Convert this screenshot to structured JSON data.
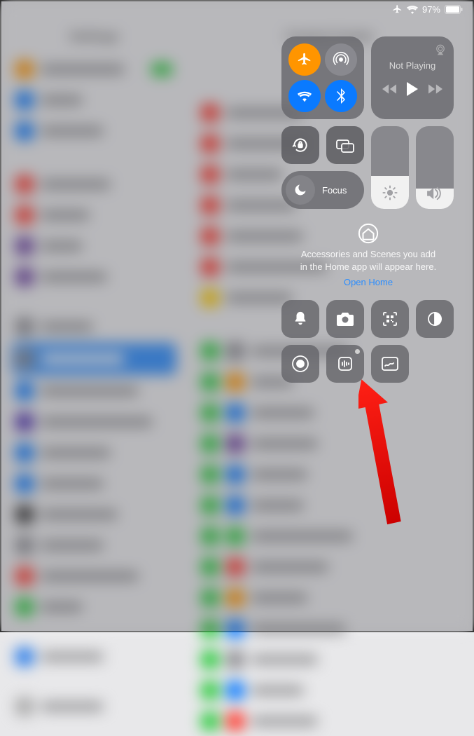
{
  "status": {
    "battery_percent": "97%"
  },
  "media": {
    "title": "Not Playing"
  },
  "focus": {
    "label": "Focus"
  },
  "sliders": {
    "brightness_pct": 40,
    "volume_pct": 25
  },
  "home": {
    "line1": "Accessories and Scenes you add",
    "line2": "in the Home app will appear here.",
    "open_label": "Open Home"
  },
  "connectivity": {
    "airplane_on": true,
    "airdrop_on": false,
    "wifi_on": true,
    "bluetooth_on": true
  }
}
